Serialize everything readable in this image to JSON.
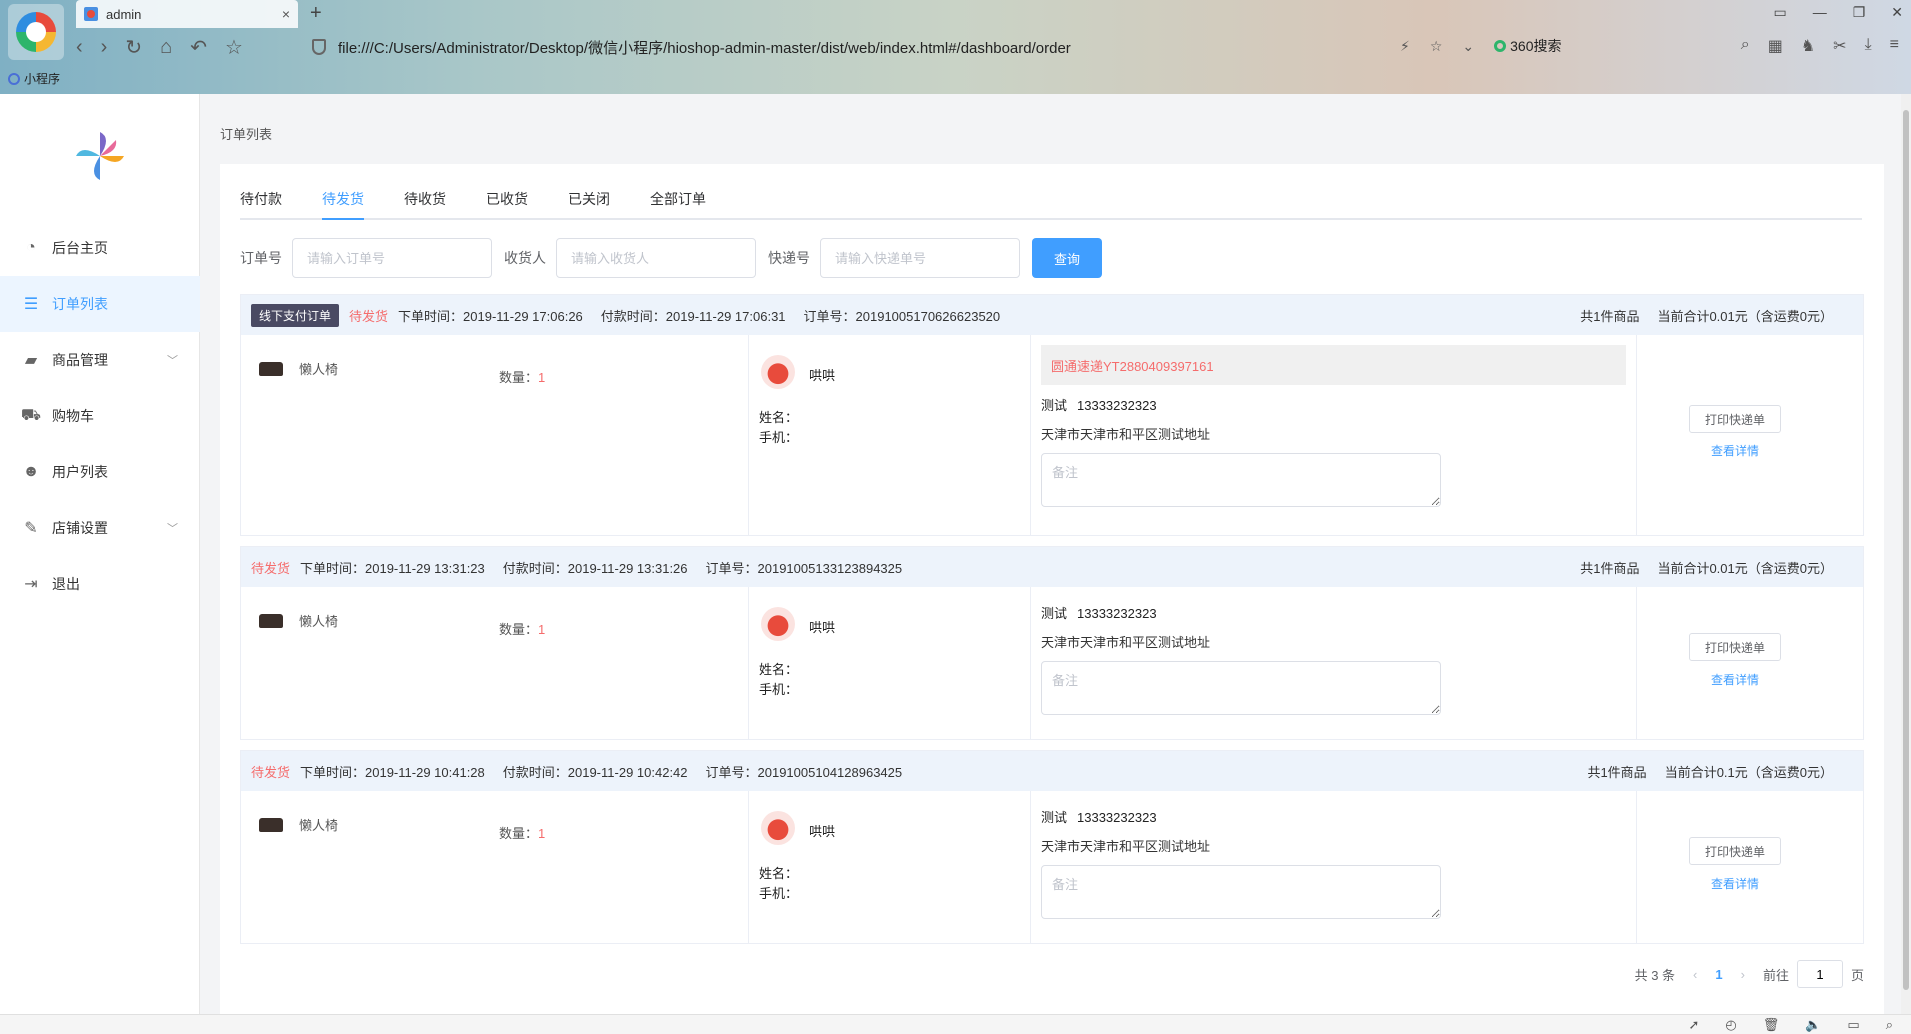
{
  "browser": {
    "tab_title": "admin",
    "tab_close": "×",
    "new_tab": "+",
    "url": "file:///C:/Users/Administrator/Desktop/微信小程序/hioshop-admin-master/dist/web/index.html#/dashboard/order",
    "search_engine": "360搜索",
    "bookmark": "小程序"
  },
  "sidebar": {
    "items": [
      {
        "label": "后台主页",
        "icon": "dashboard-icon"
      },
      {
        "label": "订单列表",
        "icon": "list-icon",
        "active": true
      },
      {
        "label": "商品管理",
        "icon": "bag-icon",
        "has_children": true
      },
      {
        "label": "购物车",
        "icon": "cart-icon"
      },
      {
        "label": "用户列表",
        "icon": "users-icon"
      },
      {
        "label": "店铺设置",
        "icon": "wrench-icon",
        "has_children": true
      },
      {
        "label": "退出",
        "icon": "logout-icon"
      }
    ]
  },
  "main": {
    "breadcrumb": "订单列表",
    "tabs": [
      "待付款",
      "待发货",
      "待收货",
      "已收货",
      "已关闭",
      "全部订单"
    ],
    "active_tab": "待发货",
    "filter": {
      "order_no_label": "订单号",
      "order_no_placeholder": "请输入订单号",
      "consignee_label": "收货人",
      "consignee_placeholder": "请输入收货人",
      "express_label": "快递号",
      "express_placeholder": "请输入快递单号",
      "search_button": "查询"
    },
    "orders": [
      {
        "tag": "线下支付订单",
        "status": "待发货",
        "order_time": "下单时间：2019-11-29 17:06:26",
        "pay_time": "付款时间：2019-11-29 17:06:31",
        "order_no": "订单号：20191005170626623520",
        "goods_count": "共1件商品",
        "total": "当前合计0.01元（含运费0元）",
        "goods_name": "懒人椅",
        "qty_label": "数量：",
        "qty": "1",
        "nickname": "哄哄",
        "name_label": "姓名：",
        "phone_label": "手机：",
        "express": "圆通速递YT2880409397161",
        "receiver_name": "测试",
        "receiver_phone": "13333232323",
        "address": "天津市天津市和平区测试地址",
        "remark_placeholder": "备注",
        "print_button": "打印快递单",
        "detail_link": "查看详情"
      },
      {
        "tag": "",
        "status": "待发货",
        "order_time": "下单时间：2019-11-29 13:31:23",
        "pay_time": "付款时间：2019-11-29 13:31:26",
        "order_no": "订单号：20191005133123894325",
        "goods_count": "共1件商品",
        "total": "当前合计0.01元（含运费0元）",
        "goods_name": "懒人椅",
        "qty_label": "数量：",
        "qty": "1",
        "nickname": "哄哄",
        "name_label": "姓名：",
        "phone_label": "手机：",
        "express": "",
        "receiver_name": "测试",
        "receiver_phone": "13333232323",
        "address": "天津市天津市和平区测试地址",
        "remark_placeholder": "备注",
        "print_button": "打印快递单",
        "detail_link": "查看详情"
      },
      {
        "tag": "",
        "status": "待发货",
        "order_time": "下单时间：2019-11-29 10:41:28",
        "pay_time": "付款时间：2019-11-29 10:42:42",
        "order_no": "订单号：20191005104128963425",
        "goods_count": "共1件商品",
        "total": "当前合计0.1元（含运费0元）",
        "goods_name": "懒人椅",
        "qty_label": "数量：",
        "qty": "1",
        "nickname": "哄哄",
        "name_label": "姓名：",
        "phone_label": "手机：",
        "express": "",
        "receiver_name": "测试",
        "receiver_phone": "13333232323",
        "address": "天津市天津市和平区测试地址",
        "remark_placeholder": "备注",
        "print_button": "打印快递单",
        "detail_link": "查看详情"
      }
    ],
    "pager": {
      "total": "共 3 条",
      "prev": "‹",
      "page": "1",
      "next": "›",
      "goto_label": "前往",
      "goto_value": "1",
      "goto_suffix": "页"
    }
  },
  "colors": {
    "accent": "#409eff",
    "danger": "#f56c6c",
    "tag_bg": "#4a4a63",
    "order_head_bg": "#edf3fb"
  }
}
